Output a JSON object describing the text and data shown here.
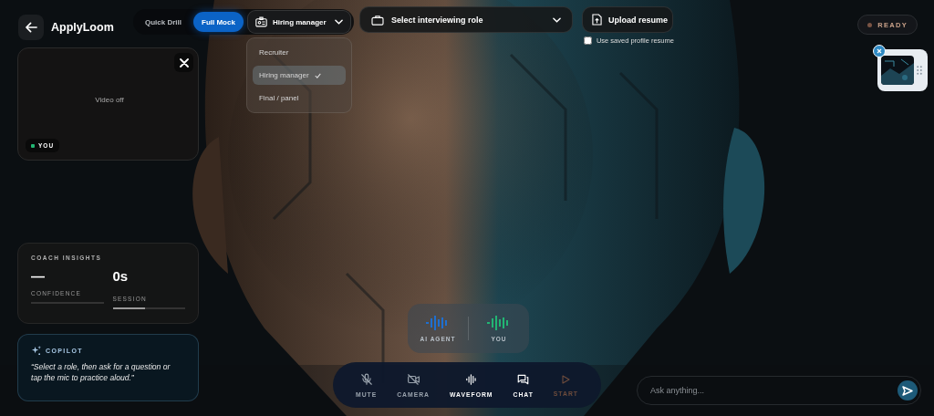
{
  "header": {
    "app_title": "ApplyLoom"
  },
  "modes": [
    {
      "label": "Quick Drill",
      "selected": false
    },
    {
      "label": "Full Mock",
      "selected": true
    }
  ],
  "interviewer_dropdown": {
    "value": "Hiring manager",
    "expanded": true,
    "options": [
      {
        "label": "Recruiter",
        "selected": false
      },
      {
        "label": "Hiring manager",
        "selected": true
      },
      {
        "label": "Final / panel",
        "selected": false
      }
    ]
  },
  "role_dropdown": {
    "value": "Select interviewing role"
  },
  "upload_button": {
    "label": "Upload resume"
  },
  "saved_resume": {
    "label": "Use saved profile resume",
    "checked": false
  },
  "status": {
    "label": "READY"
  },
  "video_tile": {
    "message": "Video off",
    "badge": "YOU"
  },
  "coach_insights": {
    "title": "COACH INSIGHTS",
    "metrics": [
      {
        "value": "—",
        "label": "CONFIDENCE",
        "level": 0
      },
      {
        "value": "0s",
        "label": "SESSION",
        "level": 0.45
      }
    ]
  },
  "copilot": {
    "title": "COPILOT",
    "message": "“Select a role, then ask for a question or tap the mic to practice aloud.”"
  },
  "speakers": [
    {
      "label": "AI AGENT",
      "color": "#1e6fd0"
    },
    {
      "label": "YOU",
      "color": "#22b573"
    }
  ],
  "controls": [
    {
      "label": "MUTE",
      "kind": "mic-off",
      "active": false,
      "disabled": false
    },
    {
      "label": "CAMERA",
      "kind": "camera-off",
      "active": false,
      "disabled": false
    },
    {
      "label": "WAVEFORM",
      "kind": "waveform",
      "active": true,
      "disabled": false
    },
    {
      "label": "CHAT",
      "kind": "chat",
      "active": true,
      "disabled": false
    },
    {
      "label": "START",
      "kind": "play",
      "active": false,
      "disabled": true
    }
  ],
  "chat_input": {
    "placeholder": "Ask anything..."
  }
}
